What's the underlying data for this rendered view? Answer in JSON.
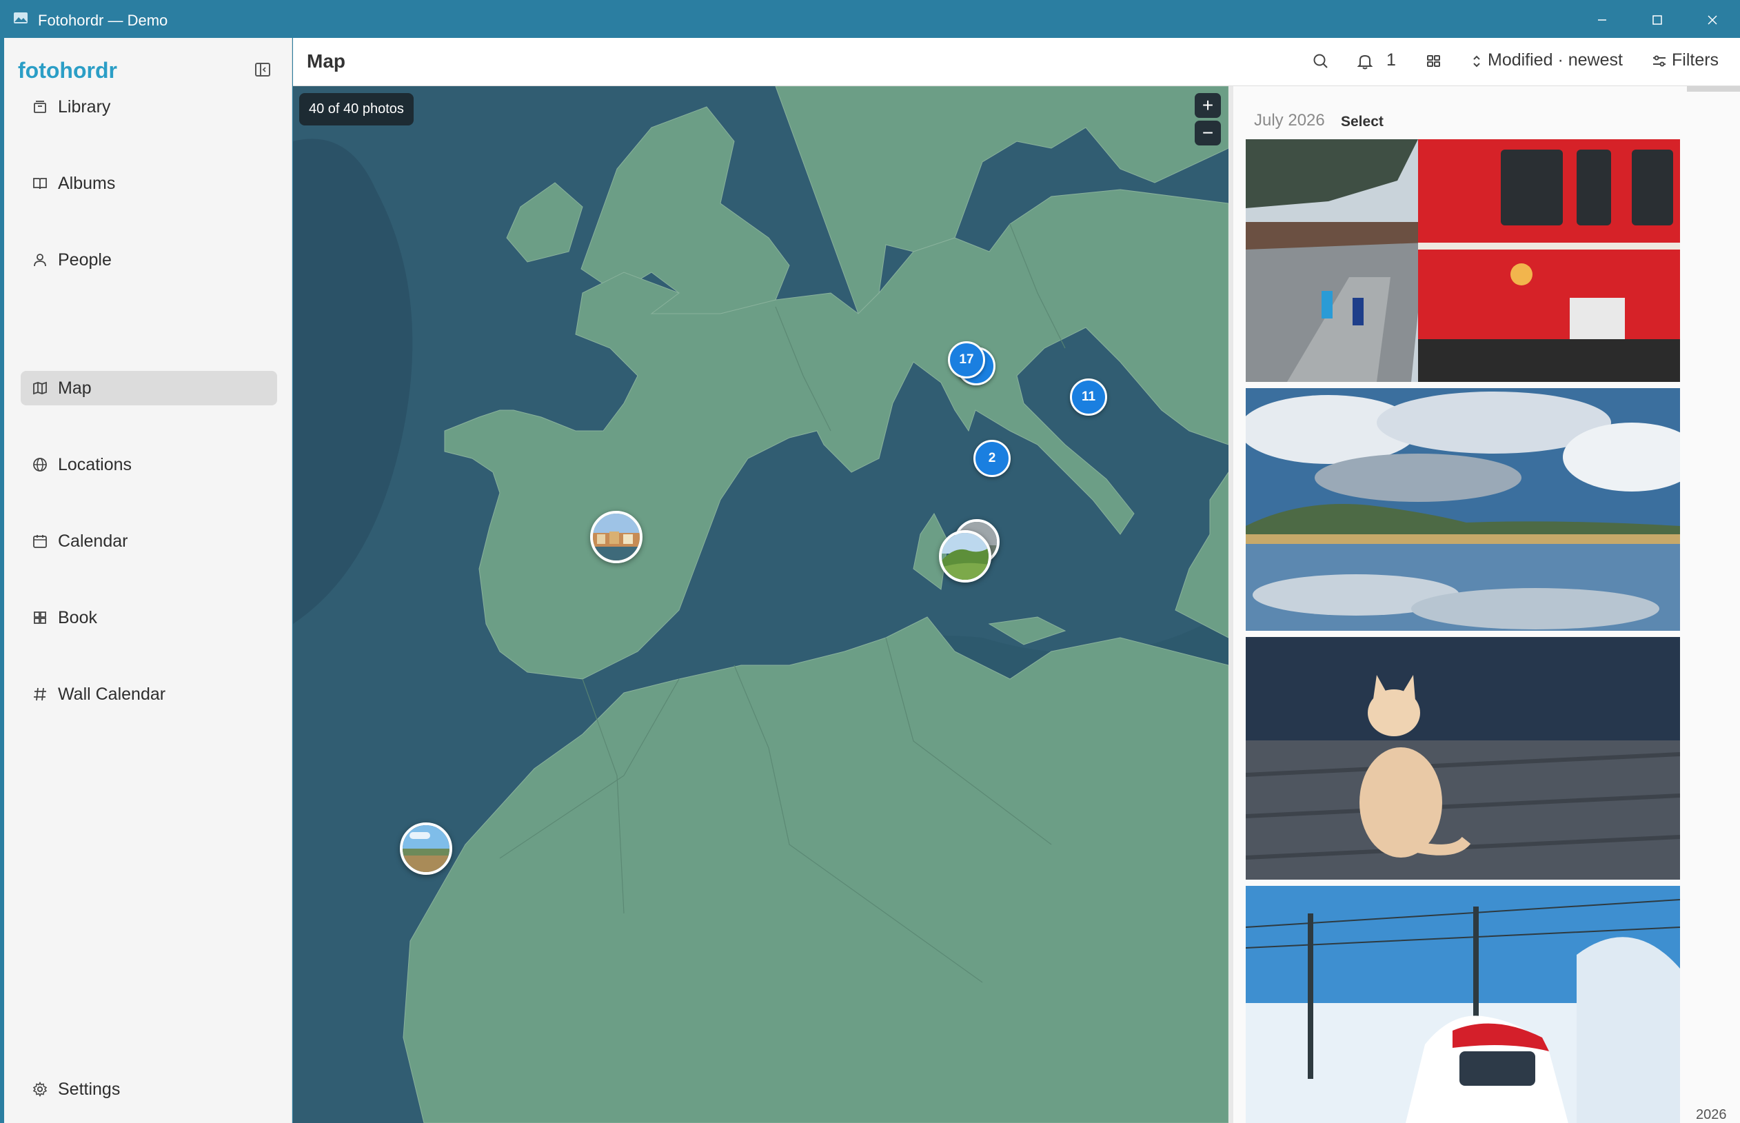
{
  "window": {
    "title": "Fotohordr — Demo"
  },
  "sidebar": {
    "brand": "fotohordr",
    "items": [
      {
        "label": "Library",
        "icon": "archive-icon"
      },
      {
        "label": "Albums",
        "icon": "book-open-icon"
      },
      {
        "label": "People",
        "icon": "person-icon"
      },
      {
        "label": "Map",
        "icon": "map-icon",
        "active": true
      },
      {
        "label": "Locations",
        "icon": "globe-icon"
      },
      {
        "label": "Calendar",
        "icon": "calendar-icon"
      },
      {
        "label": "Book",
        "icon": "grid-icon"
      },
      {
        "label": "Wall Calendar",
        "icon": "hash-icon"
      }
    ],
    "settings_label": "Settings"
  },
  "header": {
    "title": "Map",
    "notifications_count": "1",
    "sort_label": "Modified · newest",
    "filters_label": "Filters"
  },
  "map": {
    "photo_count_label": "40 of 40 photos",
    "zoom_in": "+",
    "zoom_out": "−",
    "clusters": [
      {
        "count": "17"
      },
      {
        "count": "11"
      },
      {
        "count": "2"
      }
    ]
  },
  "panel": {
    "month_label": "July 2026",
    "select_label": "Select",
    "year_label": "2026"
  },
  "colors": {
    "titlebar": "#2b7ea1",
    "brand": "#2b9ec6",
    "land": "#6c9e86",
    "sea": "#315d72",
    "cluster": "#1a7fe0"
  }
}
